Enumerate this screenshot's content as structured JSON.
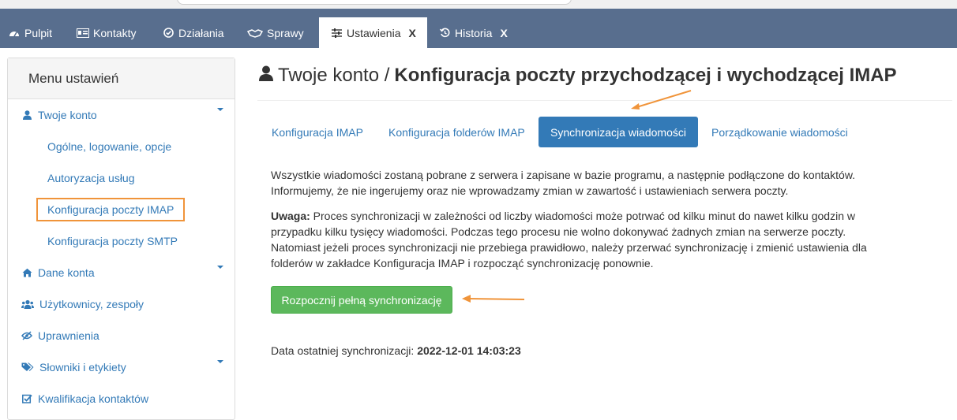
{
  "navbar": {
    "tabs": [
      {
        "label": "Pulpit",
        "icon": "dashboard-icon"
      },
      {
        "label": "Kontakty",
        "icon": "contacts-card-icon"
      },
      {
        "label": "Działania",
        "icon": "check-circle-icon"
      },
      {
        "label": "Sprawy",
        "icon": "handshake-icon"
      },
      {
        "label": "Ustawienia",
        "icon": "sliders-icon",
        "close": "X"
      },
      {
        "label": "Historia",
        "icon": "history-icon",
        "close": "X"
      }
    ]
  },
  "sidebar": {
    "title": "Menu ustawień",
    "items": [
      {
        "label": "Twoje konto",
        "icon": "user-icon"
      },
      {
        "label": "Ogólne, logowanie, opcje"
      },
      {
        "label": "Autoryzacja usług"
      },
      {
        "label": "Konfiguracja poczty IMAP"
      },
      {
        "label": "Konfiguracja poczty SMTP"
      },
      {
        "label": "Dane konta",
        "icon": "home-icon"
      },
      {
        "label": "Użytkownicy, zespoły",
        "icon": "users-icon"
      },
      {
        "label": "Uprawnienia",
        "icon": "eye-slash-icon"
      },
      {
        "label": "Słowniki i etykiety",
        "icon": "tags-icon"
      },
      {
        "label": "Kwalifikacja kontaktów",
        "icon": "checkbox-icon"
      }
    ]
  },
  "main": {
    "breadcrumb": "Twoje konto /",
    "title": "Konfiguracja poczty przychodzącej i wychodzącej IMAP",
    "tabs": [
      "Konfiguracja IMAP",
      "Konfiguracja folderów IMAP",
      "Synchronizacja wiadomości",
      "Porządkowanie wiadomości"
    ],
    "info_line1": "Wszystkie wiadomości zostaną pobrane z serwera i zapisane w bazie programu, a następnie podłączone do kontaktów.",
    "info_line2": "Informujemy, że nie ingerujemy oraz nie wprowadzamy zmian w zawartość i ustawieniach serwera poczty.",
    "warning_label": "Uwaga:",
    "warning_line1": " Proces synchronizacji w zależności od liczby wiadomości może potrwać od kilku minut do nawet kilku godzin w",
    "warning_line2": "przypadku kilku tysięcy wiadomości. Podczas tego procesu nie wolno dokonywać żadnych zmian na serwerze poczty.",
    "warning_line3": "Natomiast jeżeli proces synchronizacji nie przebiega prawidłowo, należy przerwać synchronizację i zmienić ustawienia dla",
    "warning_line4": "folderów w zakładce Konfiguracja IMAP i rozpocząć synchronizację ponownie.",
    "sync_button": "Rozpocznij pełną synchronizację",
    "last_sync_label": "Data ostatniej synchronizacji:",
    "last_sync_value": "2022-12-01 14:03:23"
  },
  "colors": {
    "navbar": "#586e8e",
    "link": "#337ab7",
    "active_tab": "#337ab7",
    "green_button": "#5cb85c",
    "annotation_orange": "#f0943a"
  }
}
